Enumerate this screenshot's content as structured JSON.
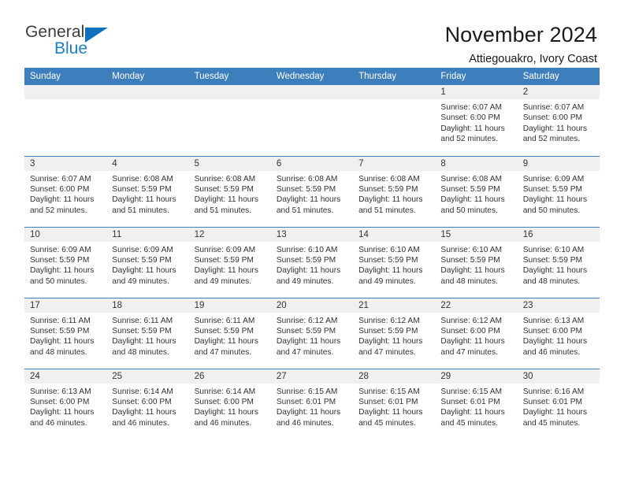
{
  "brand": {
    "name_top": "General",
    "name_bottom": "Blue",
    "mark": "triangle-logo",
    "accent_color": "#1271bd"
  },
  "header": {
    "title": "November 2024",
    "subtitle": "Attiegouakro, Ivory Coast"
  },
  "calendar": {
    "header_bg": "#3d7ebd",
    "daynum_bg": "#f0f0f0",
    "weekday_headers": [
      "Sunday",
      "Monday",
      "Tuesday",
      "Wednesday",
      "Thursday",
      "Friday",
      "Saturday"
    ],
    "weeks": [
      [
        {
          "day": "",
          "sunrise": "",
          "sunset": "",
          "daylight_line1": "",
          "daylight_line2": "",
          "empty": true
        },
        {
          "day": "",
          "sunrise": "",
          "sunset": "",
          "daylight_line1": "",
          "daylight_line2": "",
          "empty": true
        },
        {
          "day": "",
          "sunrise": "",
          "sunset": "",
          "daylight_line1": "",
          "daylight_line2": "",
          "empty": true
        },
        {
          "day": "",
          "sunrise": "",
          "sunset": "",
          "daylight_line1": "",
          "daylight_line2": "",
          "empty": true
        },
        {
          "day": "",
          "sunrise": "",
          "sunset": "",
          "daylight_line1": "",
          "daylight_line2": "",
          "empty": true
        },
        {
          "day": "1",
          "sunrise": "Sunrise: 6:07 AM",
          "sunset": "Sunset: 6:00 PM",
          "daylight_line1": "Daylight: 11 hours",
          "daylight_line2": "and 52 minutes."
        },
        {
          "day": "2",
          "sunrise": "Sunrise: 6:07 AM",
          "sunset": "Sunset: 6:00 PM",
          "daylight_line1": "Daylight: 11 hours",
          "daylight_line2": "and 52 minutes."
        }
      ],
      [
        {
          "day": "3",
          "sunrise": "Sunrise: 6:07 AM",
          "sunset": "Sunset: 6:00 PM",
          "daylight_line1": "Daylight: 11 hours",
          "daylight_line2": "and 52 minutes."
        },
        {
          "day": "4",
          "sunrise": "Sunrise: 6:08 AM",
          "sunset": "Sunset: 5:59 PM",
          "daylight_line1": "Daylight: 11 hours",
          "daylight_line2": "and 51 minutes."
        },
        {
          "day": "5",
          "sunrise": "Sunrise: 6:08 AM",
          "sunset": "Sunset: 5:59 PM",
          "daylight_line1": "Daylight: 11 hours",
          "daylight_line2": "and 51 minutes."
        },
        {
          "day": "6",
          "sunrise": "Sunrise: 6:08 AM",
          "sunset": "Sunset: 5:59 PM",
          "daylight_line1": "Daylight: 11 hours",
          "daylight_line2": "and 51 minutes."
        },
        {
          "day": "7",
          "sunrise": "Sunrise: 6:08 AM",
          "sunset": "Sunset: 5:59 PM",
          "daylight_line1": "Daylight: 11 hours",
          "daylight_line2": "and 51 minutes."
        },
        {
          "day": "8",
          "sunrise": "Sunrise: 6:08 AM",
          "sunset": "Sunset: 5:59 PM",
          "daylight_line1": "Daylight: 11 hours",
          "daylight_line2": "and 50 minutes."
        },
        {
          "day": "9",
          "sunrise": "Sunrise: 6:09 AM",
          "sunset": "Sunset: 5:59 PM",
          "daylight_line1": "Daylight: 11 hours",
          "daylight_line2": "and 50 minutes."
        }
      ],
      [
        {
          "day": "10",
          "sunrise": "Sunrise: 6:09 AM",
          "sunset": "Sunset: 5:59 PM",
          "daylight_line1": "Daylight: 11 hours",
          "daylight_line2": "and 50 minutes."
        },
        {
          "day": "11",
          "sunrise": "Sunrise: 6:09 AM",
          "sunset": "Sunset: 5:59 PM",
          "daylight_line1": "Daylight: 11 hours",
          "daylight_line2": "and 49 minutes."
        },
        {
          "day": "12",
          "sunrise": "Sunrise: 6:09 AM",
          "sunset": "Sunset: 5:59 PM",
          "daylight_line1": "Daylight: 11 hours",
          "daylight_line2": "and 49 minutes."
        },
        {
          "day": "13",
          "sunrise": "Sunrise: 6:10 AM",
          "sunset": "Sunset: 5:59 PM",
          "daylight_line1": "Daylight: 11 hours",
          "daylight_line2": "and 49 minutes."
        },
        {
          "day": "14",
          "sunrise": "Sunrise: 6:10 AM",
          "sunset": "Sunset: 5:59 PM",
          "daylight_line1": "Daylight: 11 hours",
          "daylight_line2": "and 49 minutes."
        },
        {
          "day": "15",
          "sunrise": "Sunrise: 6:10 AM",
          "sunset": "Sunset: 5:59 PM",
          "daylight_line1": "Daylight: 11 hours",
          "daylight_line2": "and 48 minutes."
        },
        {
          "day": "16",
          "sunrise": "Sunrise: 6:10 AM",
          "sunset": "Sunset: 5:59 PM",
          "daylight_line1": "Daylight: 11 hours",
          "daylight_line2": "and 48 minutes."
        }
      ],
      [
        {
          "day": "17",
          "sunrise": "Sunrise: 6:11 AM",
          "sunset": "Sunset: 5:59 PM",
          "daylight_line1": "Daylight: 11 hours",
          "daylight_line2": "and 48 minutes."
        },
        {
          "day": "18",
          "sunrise": "Sunrise: 6:11 AM",
          "sunset": "Sunset: 5:59 PM",
          "daylight_line1": "Daylight: 11 hours",
          "daylight_line2": "and 48 minutes."
        },
        {
          "day": "19",
          "sunrise": "Sunrise: 6:11 AM",
          "sunset": "Sunset: 5:59 PM",
          "daylight_line1": "Daylight: 11 hours",
          "daylight_line2": "and 47 minutes."
        },
        {
          "day": "20",
          "sunrise": "Sunrise: 6:12 AM",
          "sunset": "Sunset: 5:59 PM",
          "daylight_line1": "Daylight: 11 hours",
          "daylight_line2": "and 47 minutes."
        },
        {
          "day": "21",
          "sunrise": "Sunrise: 6:12 AM",
          "sunset": "Sunset: 5:59 PM",
          "daylight_line1": "Daylight: 11 hours",
          "daylight_line2": "and 47 minutes."
        },
        {
          "day": "22",
          "sunrise": "Sunrise: 6:12 AM",
          "sunset": "Sunset: 6:00 PM",
          "daylight_line1": "Daylight: 11 hours",
          "daylight_line2": "and 47 minutes."
        },
        {
          "day": "23",
          "sunrise": "Sunrise: 6:13 AM",
          "sunset": "Sunset: 6:00 PM",
          "daylight_line1": "Daylight: 11 hours",
          "daylight_line2": "and 46 minutes."
        }
      ],
      [
        {
          "day": "24",
          "sunrise": "Sunrise: 6:13 AM",
          "sunset": "Sunset: 6:00 PM",
          "daylight_line1": "Daylight: 11 hours",
          "daylight_line2": "and 46 minutes."
        },
        {
          "day": "25",
          "sunrise": "Sunrise: 6:14 AM",
          "sunset": "Sunset: 6:00 PM",
          "daylight_line1": "Daylight: 11 hours",
          "daylight_line2": "and 46 minutes."
        },
        {
          "day": "26",
          "sunrise": "Sunrise: 6:14 AM",
          "sunset": "Sunset: 6:00 PM",
          "daylight_line1": "Daylight: 11 hours",
          "daylight_line2": "and 46 minutes."
        },
        {
          "day": "27",
          "sunrise": "Sunrise: 6:15 AM",
          "sunset": "Sunset: 6:01 PM",
          "daylight_line1": "Daylight: 11 hours",
          "daylight_line2": "and 46 minutes."
        },
        {
          "day": "28",
          "sunrise": "Sunrise: 6:15 AM",
          "sunset": "Sunset: 6:01 PM",
          "daylight_line1": "Daylight: 11 hours",
          "daylight_line2": "and 45 minutes."
        },
        {
          "day": "29",
          "sunrise": "Sunrise: 6:15 AM",
          "sunset": "Sunset: 6:01 PM",
          "daylight_line1": "Daylight: 11 hours",
          "daylight_line2": "and 45 minutes."
        },
        {
          "day": "30",
          "sunrise": "Sunrise: 6:16 AM",
          "sunset": "Sunset: 6:01 PM",
          "daylight_line1": "Daylight: 11 hours",
          "daylight_line2": "and 45 minutes."
        }
      ]
    ]
  }
}
